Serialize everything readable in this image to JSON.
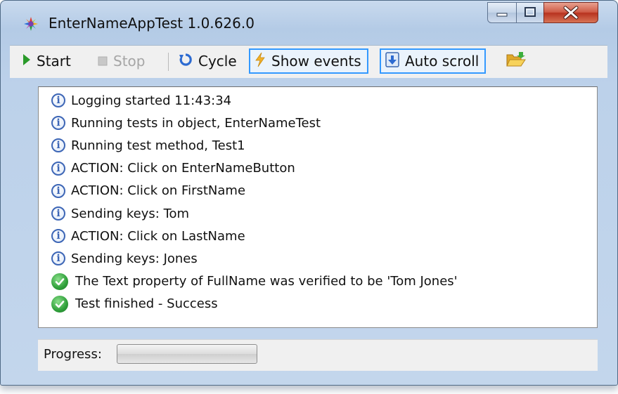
{
  "window": {
    "title": "EnterNameAppTest 1.0.626.0"
  },
  "toolbar": {
    "start_label": "Start",
    "stop_label": "Stop",
    "cycle_label": "Cycle",
    "show_events_label": "Show events",
    "auto_scroll_label": "Auto scroll",
    "stop_enabled": false,
    "show_events_checked": true,
    "auto_scroll_checked": true
  },
  "log": {
    "entries": [
      {
        "type": "info",
        "text": "Logging started 11:43:34"
      },
      {
        "type": "info",
        "text": "Running tests in object, EnterNameTest"
      },
      {
        "type": "info",
        "text": "Running test method, Test1"
      },
      {
        "type": "info",
        "text": "ACTION: Click on EnterNameButton"
      },
      {
        "type": "info",
        "text": "ACTION: Click on FirstName"
      },
      {
        "type": "info",
        "text": "Sending keys: Tom"
      },
      {
        "type": "info",
        "text": "ACTION: Click on LastName"
      },
      {
        "type": "info",
        "text": "Sending keys: Jones"
      },
      {
        "type": "success",
        "text": "The Text property of FullName was verified to be 'Tom Jones'"
      },
      {
        "type": "success",
        "text": "Test finished - Success"
      }
    ]
  },
  "status": {
    "progress_label": "Progress:",
    "progress_fraction": 0
  },
  "colors": {
    "accent": "#3399ff",
    "info": "#3d66b6",
    "success": "#2f9f3a"
  }
}
